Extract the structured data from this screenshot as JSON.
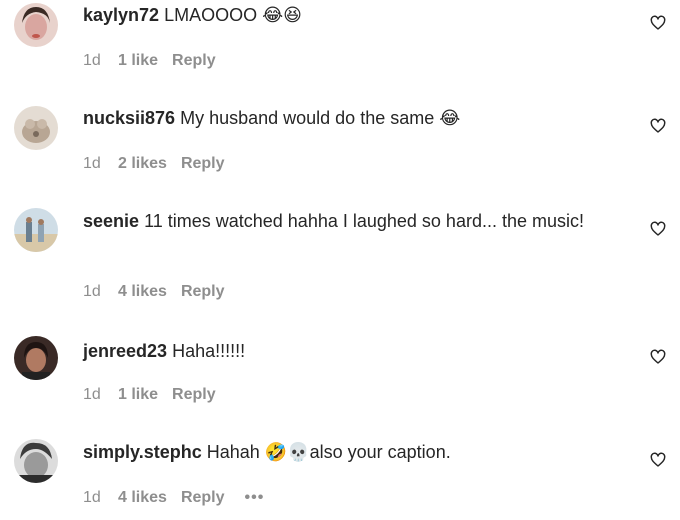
{
  "comments": [
    {
      "username": "kaylyn72",
      "text": "LMAOOOO",
      "emoji": "😂😆",
      "time": "1d",
      "likes": "1 like",
      "reply": "Reply",
      "avatar_color": "#d9a6a0"
    },
    {
      "username": "nucksii876",
      "text": "My husband would do the same",
      "emoji": "😂",
      "time": "1d",
      "likes": "2 likes",
      "reply": "Reply",
      "avatar_color": "#c9b9a9"
    },
    {
      "username": "seenie",
      "text": "11 times watched hahha I laughed so hard... the music!",
      "emoji": "",
      "time": "1d",
      "likes": "4 likes",
      "reply": "Reply",
      "avatar_color": "#8fa3b3"
    },
    {
      "username": "jenreed23",
      "text": "Haha!!!!!!",
      "emoji": "",
      "time": "1d",
      "likes": "1 like",
      "reply": "Reply",
      "avatar_color": "#5a4038"
    },
    {
      "username": "simply.stephc",
      "text_before": "Hahah",
      "emoji": "🤣💀",
      "text_after": "also your caption.",
      "time": "1d",
      "likes": "4 likes",
      "reply": "Reply",
      "more": "•••",
      "avatar_color": "#a9a9a9"
    }
  ],
  "icons": {
    "like": "heart-outline-icon",
    "more": "more-options-icon"
  },
  "colors": {
    "text": "#262626",
    "secondary": "#8e8e8e",
    "background": "#ffffff"
  }
}
